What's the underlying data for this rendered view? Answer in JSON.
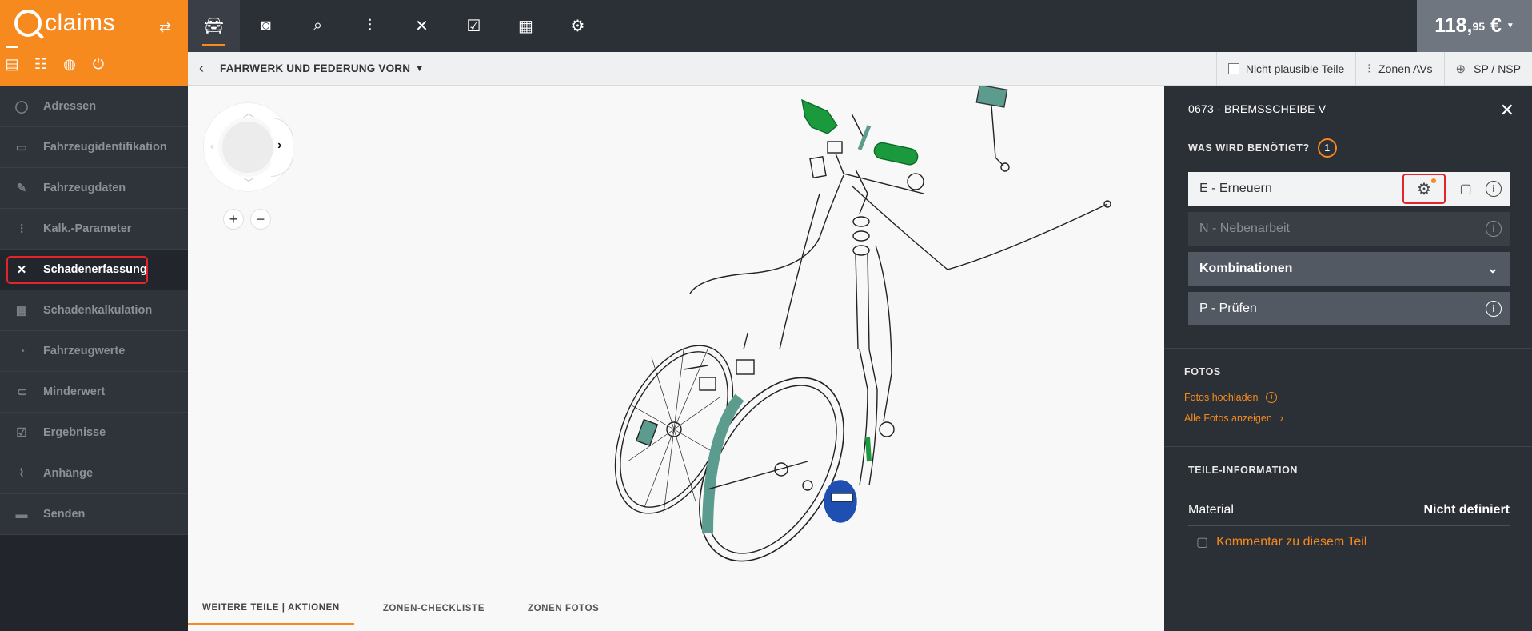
{
  "brand": {
    "name": "claims"
  },
  "sidebar": {
    "items": [
      {
        "label": "Adressen",
        "icon": "person-icon"
      },
      {
        "label": "Fahrzeugidentifikation",
        "icon": "car-icon"
      },
      {
        "label": "Fahrzeugdaten",
        "icon": "edit-icon"
      },
      {
        "label": "Kalk.-Parameter",
        "icon": "sliders-icon"
      },
      {
        "label": "Schadenerfassung",
        "icon": "tools-icon"
      },
      {
        "label": "Schadenkalkulation",
        "icon": "calc-icon"
      },
      {
        "label": "Fahrzeugwerte",
        "icon": "gauge-icon"
      },
      {
        "label": "Minderwert",
        "icon": "toggle-icon"
      },
      {
        "label": "Ergebnisse",
        "icon": "check-doc-icon"
      },
      {
        "label": "Anhänge",
        "icon": "paperclip-icon"
      },
      {
        "label": "Senden",
        "icon": "send-icon"
      }
    ],
    "active_index": 4
  },
  "toolbar": {
    "price_main": "118,",
    "price_cents": "95",
    "price_currency": "€"
  },
  "subbar": {
    "title": "FAHRWERK UND FEDERUNG VORN",
    "nicht_plausibel": "Nicht plausible Teile",
    "zonen_avs": "Zonen AVs",
    "sp_nsp": "SP / NSP"
  },
  "bottom_tabs": [
    "WEITERE TEILE | AKTIONEN",
    "ZONEN-CHECKLISTE",
    "ZONEN FOTOS"
  ],
  "panel": {
    "title": "0673 - BREMSSCHEIBE V",
    "needed_title": "WAS WIRD BENÖTIGT?",
    "needed_count": "1",
    "options": {
      "erneuern": "E - Erneuern",
      "nebenarbeit": "N - Nebenarbeit",
      "kombinationen": "Kombinationen",
      "pruefen": "P - Prüfen"
    },
    "fotos_title": "FOTOS",
    "fotos_upload": "Fotos hochladen",
    "fotos_all": "Alle Fotos anzeigen",
    "teile_title": "TEILE-INFORMATION",
    "material_label": "Material",
    "material_value": "Nicht definiert",
    "comment": "Kommentar zu diesem Teil"
  },
  "colors": {
    "accent": "#f68a1f",
    "highlight": "#e3242b",
    "part_green": "#1a9a3c",
    "part_teal": "#5c9c8e",
    "part_blue": "#1f4fb0"
  }
}
